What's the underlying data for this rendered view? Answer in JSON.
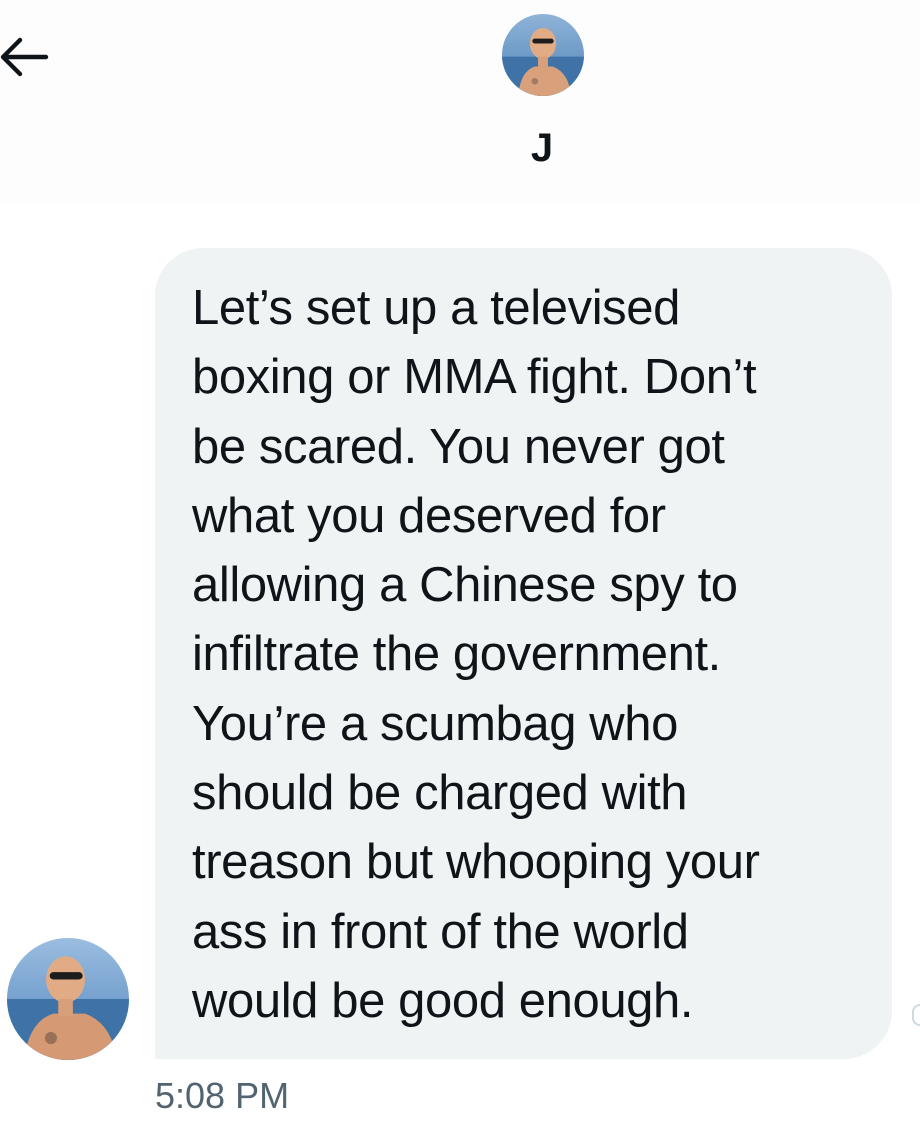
{
  "conversation": {
    "contact_name": "J",
    "back_icon": "arrow-left-icon"
  },
  "message": {
    "text": "Let’s set up a televised\nboxing or MMA fight. Don’t\nbe scared.  You never got\nwhat you deserved for\nallowing a Chinese spy to\ninfiltrate the government.\nYou’re a scumbag who\nshould be charged with\ntreason but whooping your\nass in front of the world\nwould be good enough.",
    "timestamp": "5:08 PM"
  },
  "colors": {
    "bubble_bg": "#eff3f4",
    "text": "#0f1419",
    "secondary_text": "#536471",
    "header_bg": "#fdfdfe"
  }
}
